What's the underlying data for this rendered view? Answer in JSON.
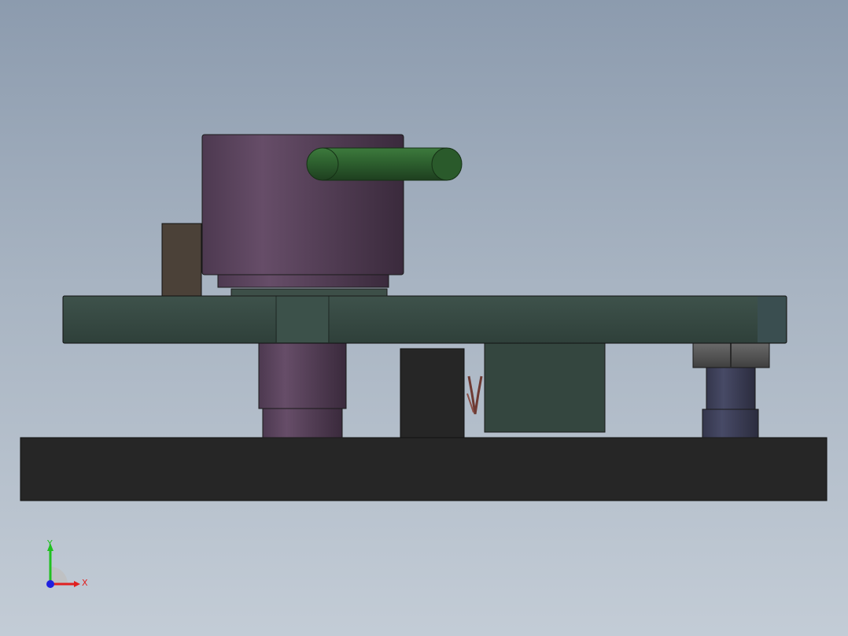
{
  "viewport": {
    "background_top": "#8c9bae",
    "background_bottom": "#c3ccd6"
  },
  "model": {
    "parts": [
      {
        "name": "base-plate",
        "color": "#262626"
      },
      {
        "name": "top-plate",
        "color": "#34463f"
      },
      {
        "name": "cylinder-body",
        "color": "#5e4560"
      },
      {
        "name": "green-lever",
        "color": "#2d5a2d"
      },
      {
        "name": "left-block",
        "color": "#4b4138"
      },
      {
        "name": "black-block",
        "color": "#262626"
      },
      {
        "name": "green-block",
        "color": "#34463f"
      },
      {
        "name": "spring",
        "color": "#6e3a33"
      },
      {
        "name": "hex-nut",
        "color": "#505050"
      },
      {
        "name": "support-post",
        "color": "#3b3d55"
      }
    ]
  },
  "triad": {
    "x_label": "X",
    "y_label": "Y",
    "x_color": "#e02020",
    "y_color": "#20c020",
    "z_color": "#2020e0"
  }
}
